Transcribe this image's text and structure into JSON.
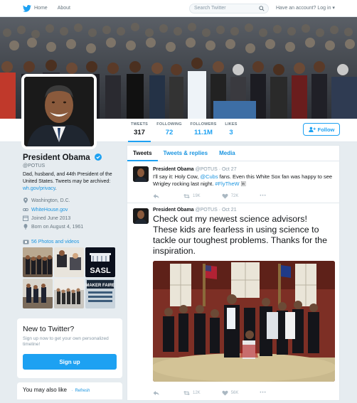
{
  "nav": {
    "home_label": "Home",
    "about_label": "About",
    "search_placeholder": "Search Twitter",
    "have_account": "Have an account?",
    "login_label": "Log in",
    "login_caret": "▾"
  },
  "profile_nav": {
    "stats": [
      {
        "label": "TWEETS",
        "value": "317"
      },
      {
        "label": "FOLLOWING",
        "value": "72"
      },
      {
        "label": "FOLLOWERS",
        "value": "11.1M"
      },
      {
        "label": "LIKES",
        "value": "3"
      }
    ],
    "follow_label": "Follow"
  },
  "profile": {
    "name": "President Obama",
    "handle": "@POTUS",
    "bio": "Dad, husband, and 44th President of the United States. Tweets may be archived:",
    "bio_link": "wh.gov/privacy",
    "bio_end": ".",
    "location": "Washington, D.C.",
    "website": "WhiteHouse.gov",
    "joined": "Joined June 2013",
    "born": "Born on August 4, 1961",
    "photos_label": "56 Photos and videos",
    "thumb_text_1": "SASL",
    "thumb_text_2": "MAKER FAIRE"
  },
  "signup_box": {
    "title": "New to Twitter?",
    "subtitle": "Sign up now to get your own personalized timeline!",
    "button": "Sign up"
  },
  "may_like": {
    "title": "You may also like",
    "separator": "·",
    "refresh": "Refresh"
  },
  "timeline": {
    "tabs": [
      "Tweets",
      "Tweets & replies",
      "Media"
    ],
    "tweets": [
      {
        "name": "President Obama",
        "meta": "@POTUS · Oct 27",
        "text_a": "I'll say it: Holy Cow, ",
        "mention": "@Cubs",
        "text_b": " fans. Even this White Sox fan was happy to see Wrigley rocking last night. ",
        "hashtag": "#FlyTheW",
        "emoji": "🅆",
        "retweets": "19K",
        "likes": "72K"
      },
      {
        "name": "President Obama",
        "meta": "@POTUS · Oct 21",
        "text": "Check out my newest science advisors! These kids are fearless in using science to tackle our toughest problems. Thanks for the inspiration.",
        "retweets": "12K",
        "likes": "56K"
      }
    ]
  },
  "colors": {
    "accent": "#1da1f2",
    "link": "#1b95e0",
    "background": "#e6ecf0"
  }
}
